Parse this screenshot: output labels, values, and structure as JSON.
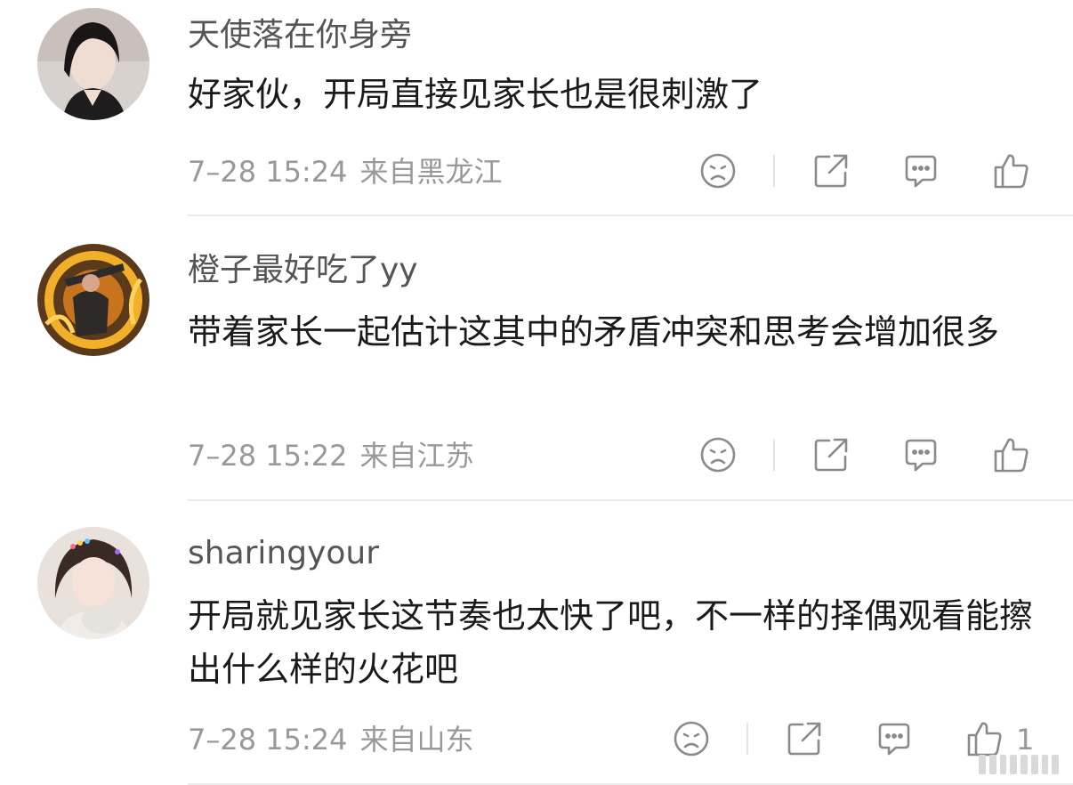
{
  "comments": [
    {
      "username": "天使落在你身旁",
      "text": "好家伙，开局直接见家长也是很刺激了",
      "time": "7–28 15:24",
      "location": "来自黑龙江",
      "like_count": ""
    },
    {
      "username": "橙子最好吃了yy",
      "text": "带着家长一起估计这其中的矛盾冲突和思考会增加很多",
      "time": "7–28 15:22",
      "location": "来自江苏",
      "like_count": ""
    },
    {
      "username": "sharingyour",
      "text": "开局就见家长这节奏也太快了吧，不一样的择偶观看能擦出什么样的火花吧",
      "time": "7–28 15:24",
      "location": "来自山东",
      "like_count": "1"
    }
  ],
  "icons": {
    "dislike": "sad-face-icon",
    "share": "share-icon",
    "reply": "comment-bubble-icon",
    "like": "thumbs-up-icon"
  },
  "colors": {
    "icon": "#8a8a8a",
    "meta_text": "#999999",
    "username": "#555555",
    "body_text": "#1a1a1a",
    "divider": "#ececec"
  }
}
